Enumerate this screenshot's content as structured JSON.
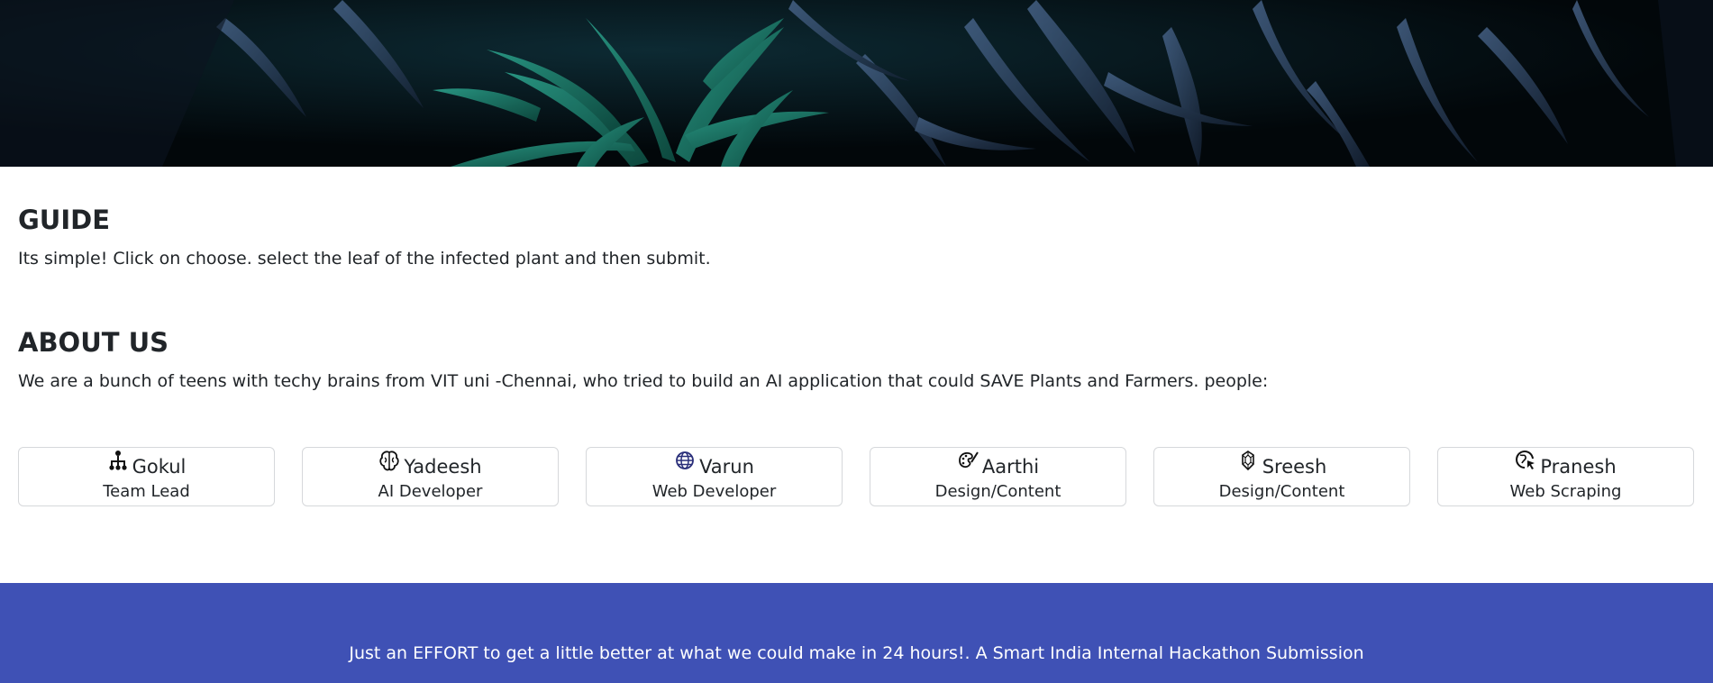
{
  "guide": {
    "heading": "GUIDE",
    "text": "Its simple! Click on choose. select the leaf of the infected plant and then submit."
  },
  "about": {
    "heading": "ABOUT US",
    "text": "We are a bunch of teens with techy brains from VIT uni -Chennai, who tried to build an AI application that could SAVE Plants and Farmers. people:"
  },
  "team": [
    {
      "name": "Gokul",
      "role": "Team Lead",
      "icon": "org-chart-icon"
    },
    {
      "name": "Yadeesh",
      "role": "AI Developer",
      "icon": "brain-icon"
    },
    {
      "name": "Varun",
      "role": "Web Developer",
      "icon": "globe-icon"
    },
    {
      "name": "Aarthi",
      "role": "Design/Content",
      "icon": "palette-icon"
    },
    {
      "name": "Sreesh",
      "role": "Design/Content",
      "icon": "gem-icon"
    },
    {
      "name": "Pranesh",
      "role": "Web Scraping",
      "icon": "globe-cursor-icon"
    }
  ],
  "footer": {
    "text": "Just an EFFORT to get a little better at what we could make in 24 hours!. A Smart India Internal Hackathon Submission"
  },
  "colors": {
    "footer_bg": "#3f51b5",
    "hero_bg": "#03080c",
    "text": "#212529"
  }
}
